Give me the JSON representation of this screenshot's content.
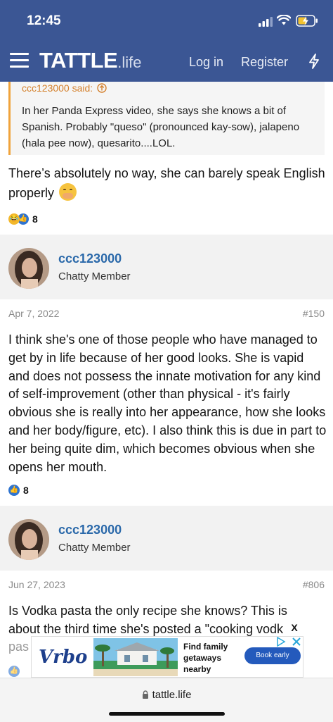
{
  "status_bar": {
    "time": "12:45"
  },
  "navbar": {
    "logo_main": "TATTLE",
    "logo_ext": ".life",
    "login": "Log in",
    "register": "Register"
  },
  "quote": {
    "author": "ccc123000 said:",
    "text": "In her Panda Express video, she says she knows a bit of Spanish. Probably \"queso\" (pronounced kay-sow), jalapeno (hala pee now), quesarito....LOL."
  },
  "reply": {
    "text": "There’s absolutely no way, she can barely speak English properly",
    "reaction_count": "8"
  },
  "posts": [
    {
      "username": "ccc123000",
      "user_title": "Chatty Member",
      "date": "Apr 7, 2022",
      "number": "#150",
      "text": "I think she's one of those people who have managed to get by in life because of her good looks. She is vapid and does not possess the innate motivation for any kind of self-improvement (other than physical - it's fairly obvious she is really into her appearance, how she looks and her body/figure, etc). I also think this is due in part to her being quite dim, which becomes obvious when she opens her mouth.",
      "reaction_count": "8"
    },
    {
      "username": "ccc123000",
      "user_title": "Chatty Member",
      "date": "Jun 27, 2023",
      "number": "#806",
      "text": "Is Vodka pasta the only recipe she knows? This is about the third time she's posted a \"cooking vodk",
      "text_partial": "pas"
    }
  ],
  "ad": {
    "brand": "Vrbo",
    "text": "Find family getaways nearby",
    "button": "Book early",
    "close": "X"
  },
  "browser": {
    "url": "tattle.life"
  },
  "colors": {
    "header": "#3b5694",
    "link": "#2b69aa",
    "quote_border": "#f0a33b",
    "ad_button": "#245abc"
  }
}
